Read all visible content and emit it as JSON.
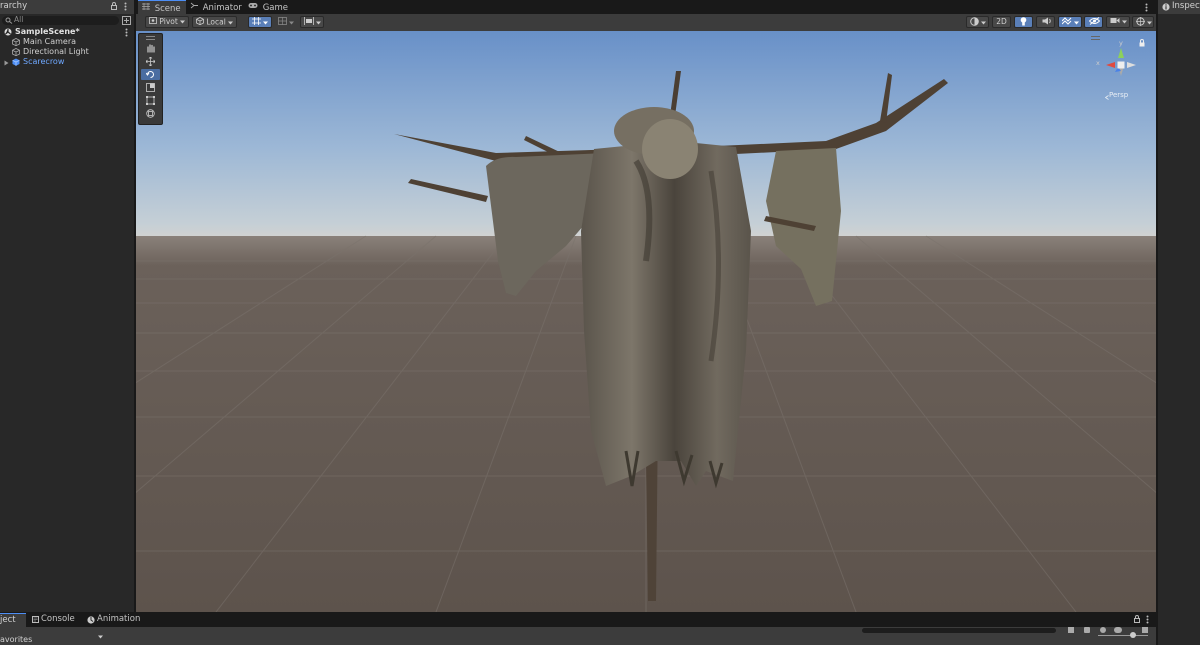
{
  "hierarchy": {
    "tab_label": "rarchy",
    "search_placeholder": "All",
    "scene_name": "SampleScene*",
    "items": [
      {
        "label": "Main Camera"
      },
      {
        "label": "Directional Light"
      },
      {
        "label": "Scarecrow"
      }
    ]
  },
  "scene_tabs": [
    {
      "label": "Scene",
      "icon": "grid-icon",
      "active": true
    },
    {
      "label": "Animator",
      "icon": "animator-icon",
      "active": false
    },
    {
      "label": "Game",
      "icon": "gamepad-icon",
      "active": false
    }
  ],
  "toolbar": {
    "pivot_label": "Pivot",
    "local_label": "Local",
    "twod_label": "2D"
  },
  "gizmo": {
    "x_label": "x",
    "y_label": "y",
    "persp_label": "Persp"
  },
  "inspector": {
    "tab_label": "Inspecto"
  },
  "bottom": {
    "tabs": [
      {
        "label": "ject",
        "icon": "folder-icon"
      },
      {
        "label": "Console",
        "icon": "console-icon"
      },
      {
        "label": "Animation",
        "icon": "animation-icon"
      }
    ],
    "favorites_label": "avorites"
  },
  "colors": {
    "accent": "#4d8ef5",
    "selected_text": "#6fa8ff",
    "sky_top": "#6e93c9",
    "ground": "#625850"
  }
}
